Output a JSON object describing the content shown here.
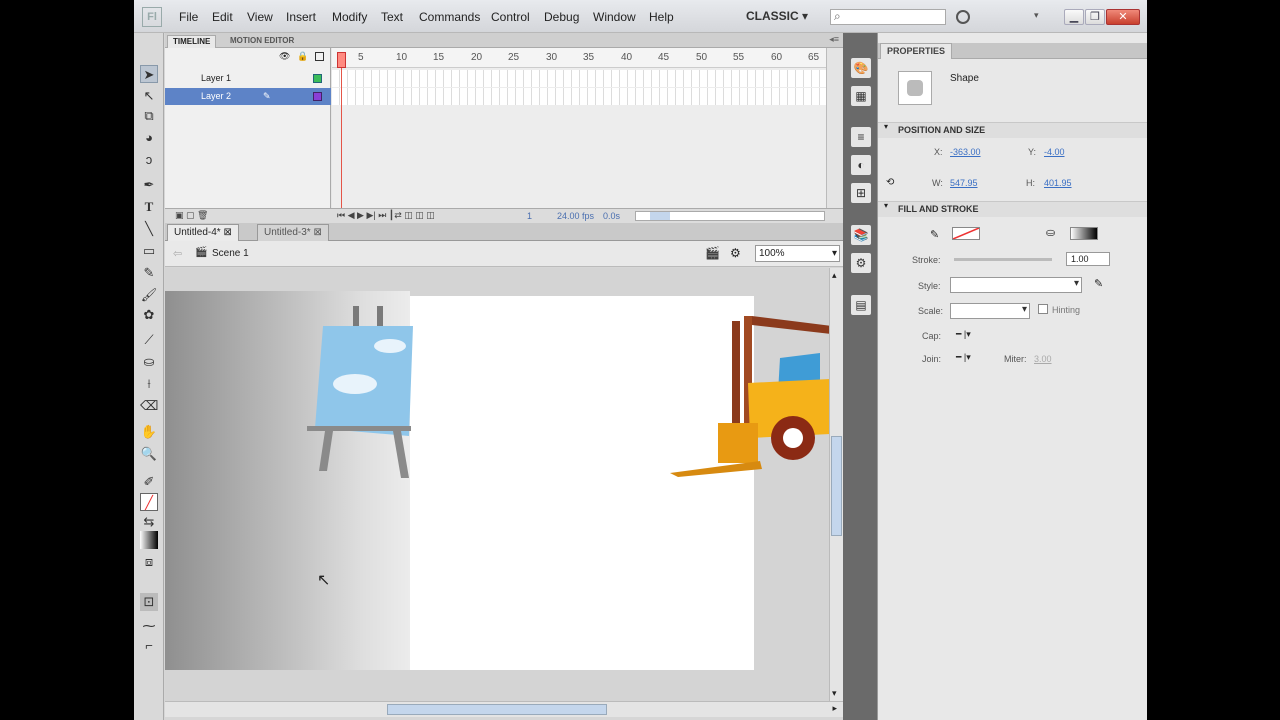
{
  "app": {
    "logo": "Fl",
    "workspace": "CLASSIC ▾",
    "search_glyph": "⌕"
  },
  "menu": [
    "File",
    "Edit",
    "View",
    "Insert",
    "Modify",
    "Text",
    "Commands",
    "Control",
    "Debug",
    "Window",
    "Help"
  ],
  "timeline": {
    "tabs": [
      "TIMELINE",
      "MOTION EDITOR"
    ],
    "layers": [
      {
        "name": "Layer 1"
      },
      {
        "name": "Layer 2"
      }
    ],
    "frame_numbers": [
      "5",
      "10",
      "15",
      "20",
      "25",
      "30",
      "35",
      "40",
      "45",
      "50",
      "55",
      "60",
      "65"
    ],
    "fps": "24.00 fps",
    "time": "0.0s",
    "frame": "1"
  },
  "documents": {
    "tabs": [
      "Untitled-4*",
      "Untitled-3*"
    ]
  },
  "editbar": {
    "scene": "Scene 1",
    "zoom": "100%"
  },
  "properties": {
    "tab": "PROPERTIES",
    "object_type": "Shape",
    "position_size": {
      "header": "POSITION AND SIZE",
      "x_label": "X:",
      "x": "-363.00",
      "y_label": "Y:",
      "y": "-4.00",
      "w_label": "W:",
      "w": "547.95",
      "h_label": "H:",
      "h": "401.95"
    },
    "fill_stroke": {
      "header": "FILL AND STROKE",
      "stroke_label": "Stroke:",
      "stroke_value": "1.00",
      "style_label": "Style:",
      "scale_label": "Scale:",
      "hinting_label": "Hinting",
      "cap_label": "Cap:",
      "join_label": "Join:",
      "miter_label": "Miter:",
      "miter_value": "3.00"
    }
  },
  "colors": {
    "accent": "#5d83c7",
    "playhead": "#e45548",
    "link": "#3a6fc4"
  }
}
